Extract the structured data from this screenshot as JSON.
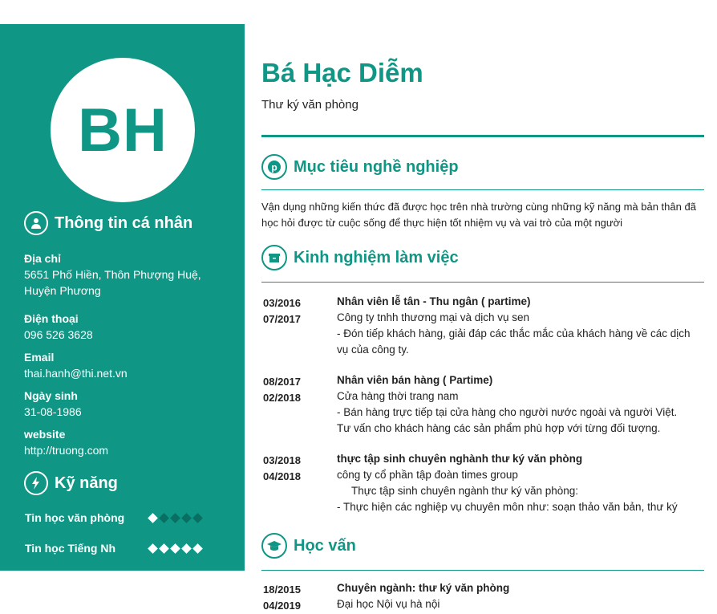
{
  "profile": {
    "initials": "BH",
    "name": "Bá Hạc Diễm",
    "role": "Thư ký văn phòng"
  },
  "personal": {
    "heading": "Thông tin cá nhân",
    "address_label": "Địa chỉ",
    "address_value": "5651 Phố Hiền, Thôn Phượng Huệ, Huyện Phương",
    "phone_label": "Điện thoại",
    "phone_value": "096 526 3628",
    "email_label": "Email",
    "email_value": "thai.hanh@thi.net.vn",
    "birthday_label": "Ngày sinh",
    "birthday_value": "31-08-1986",
    "website_label": "website",
    "website_value": "http://truong.com"
  },
  "skills": {
    "heading": "Kỹ năng",
    "items": [
      {
        "name": "Tin học văn phòng",
        "level": 1,
        "max": 5
      },
      {
        "name": "Tin học Tiếng Nh",
        "level": 5,
        "max": 5
      }
    ]
  },
  "objective": {
    "heading": "Mục tiêu nghề nghiệp",
    "text": "Vận dụng những kiến thức đã được học trên nhà trường cùng những kỹ năng mà bản thân đã học hỏi được từ cuộc sống để thực hiện tốt nhiệm vụ và vai trò của một người"
  },
  "experience": {
    "heading": "Kinh nghiệm làm việc",
    "entries": [
      {
        "from": "03/2016",
        "to": "07/2017",
        "title": "Nhân viên lễ tân - Thu ngân ( partime)",
        "company": "Công ty tnhh thương mại và dịch vụ sen",
        "desc1": "- Đón tiếp khách hàng, giải đáp các thắc mắc của khách hàng về các dịch vụ của công ty.",
        "desc2": ""
      },
      {
        "from": "08/2017",
        "to": "02/2018",
        "title": "Nhân viên bán hàng ( Partime)",
        "company": "Cửa hàng thời trang nam",
        "desc1": "- Bán hàng trực tiếp tại cửa hàng cho người nước ngoài và người Việt.",
        "desc2": "Tư vấn cho khách hàng các sản phẩm phù hợp với từng đối tượng."
      },
      {
        "from": "03/2018",
        "to": "04/2018",
        "title": "thực tập sinh chuyên nghành thư ký văn phòng",
        "company": "công ty cổ phần tập đoàn times group",
        "desc1": "Thực tập sinh chuyên ngành thư ký văn phòng:",
        "desc2": "- Thực hiện các nghiệp vụ chuyên môn như: soạn thảo văn bản, thư ký"
      }
    ]
  },
  "education": {
    "heading": "Học vấn",
    "entries": [
      {
        "from": "18/2015",
        "to": "04/2019",
        "title": "Chuyên ngành: thư ký văn phòng",
        "school": "Đại học Nội vụ hà nội"
      }
    ]
  },
  "colors": {
    "accent": "#0f9685",
    "sidebar_bg": "#0f9685",
    "text": "#222222"
  }
}
